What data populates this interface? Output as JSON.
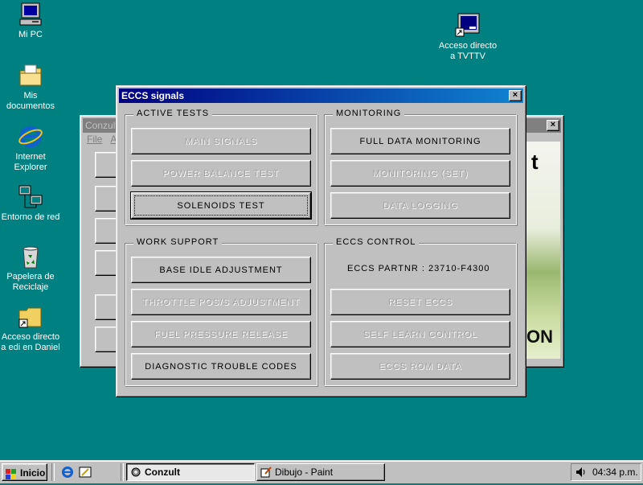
{
  "desktop": {
    "icons": [
      {
        "label": "Mi PC"
      },
      {
        "label": "Mis documentos"
      },
      {
        "label": "Internet Explorer"
      },
      {
        "label": "Entorno de red"
      },
      {
        "label": "Papelera de Reciclaje"
      },
      {
        "label": "Acceso directo a edi en Daniel"
      },
      {
        "label": "Acceso directo a TVTTV"
      }
    ]
  },
  "conzult_window": {
    "title": "Conzult",
    "menu": [
      "File",
      "A"
    ],
    "close_glyph": "×",
    "brand_fragment_top": "t",
    "brand_fragment_bottom": "ON"
  },
  "eccs_dialog": {
    "title": "ECCS signals",
    "close_glyph": "×",
    "groups": {
      "active_tests": {
        "label": "ACTIVE TESTS",
        "buttons": [
          "MAIN SIGNALS",
          "POWER BALANCE TEST",
          "SOLENOIDS TEST"
        ]
      },
      "monitoring": {
        "label": "MONITORING",
        "buttons": [
          "FULL DATA MONITORING",
          "MONITORING (SET)",
          "DATA LOGGING"
        ]
      },
      "work_support": {
        "label": "WORK SUPPORT",
        "buttons": [
          "BASE IDLE ADJUSTMENT",
          "THROTTLE POS/S ADJUSTMENT",
          "FUEL PRESSURE RELEASE",
          "DIAGNOSTIC TROUBLE CODES"
        ]
      },
      "eccs_control": {
        "label": "ECCS CONTROL",
        "partnr": "ECCS PARTNR : 23710-F4300",
        "buttons": [
          "RESET ECCS",
          "SELF LEARN CONTROL",
          "ECCS ROM DATA"
        ]
      }
    }
  },
  "taskbar": {
    "start_label": "Inicio",
    "tasks": [
      {
        "label": "Conzult",
        "active": true
      },
      {
        "label": "Dibujo - Paint",
        "active": false
      }
    ],
    "clock": "04:34 p.m."
  },
  "colors": {
    "desktop": "#008080",
    "title_active_start": "#000080",
    "title_active_end": "#1084d0",
    "title_inactive": "#808080",
    "disabled_text": "#a0a0a0"
  }
}
